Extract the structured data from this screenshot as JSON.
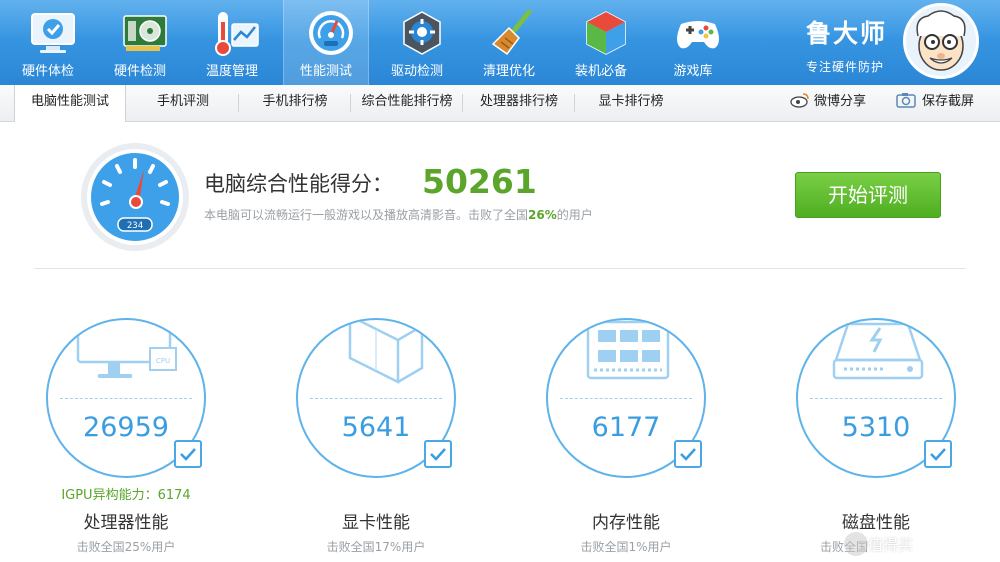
{
  "toolbar": {
    "items": [
      {
        "label": "硬件体检",
        "icon": "monitor-health-icon"
      },
      {
        "label": "硬件检测",
        "icon": "graphics-card-icon"
      },
      {
        "label": "温度管理",
        "icon": "thermometer-chart-icon"
      },
      {
        "label": "性能测试",
        "icon": "speedometer-icon"
      },
      {
        "label": "驱动检测",
        "icon": "gear-disc-icon"
      },
      {
        "label": "清理优化",
        "icon": "broom-icon"
      },
      {
        "label": "装机必备",
        "icon": "cube-box-icon"
      },
      {
        "label": "游戏库",
        "icon": "gamepad-icon"
      }
    ],
    "active_index": 3
  },
  "brand": {
    "name": "鲁大师",
    "slogan": "专注硬件防护",
    "avatar_icon": "ludashi-avatar-icon"
  },
  "tabs": {
    "items": [
      "电脑性能测试",
      "手机评测",
      "手机排行榜",
      "综合性能排行榜",
      "处理器排行榜",
      "显卡排行榜"
    ],
    "active_index": 0
  },
  "actions": {
    "share_label": "微博分享",
    "share_icon": "weibo-icon",
    "screenshot_label": "保存截屏",
    "screenshot_icon": "camera-icon"
  },
  "score": {
    "title": "电脑综合性能得分：",
    "value": "50261",
    "gauge_digits": "234",
    "desc_before": "本电脑可以流畅运行一般游戏以及播放高清影音。击败了全国",
    "desc_percent": "26%",
    "desc_after": "的用户"
  },
  "start_button": {
    "label": "开始评测"
  },
  "cards": [
    {
      "score": "26959",
      "title": "处理器性能",
      "sub": "击败全国25%用户",
      "extra": "IGPU异构能力：6174",
      "icon": "cpu-monitor-icon",
      "checked": true
    },
    {
      "score": "5641",
      "title": "显卡性能",
      "sub": "击败全国17%用户",
      "extra": "",
      "icon": "graphics-cube-icon",
      "checked": true
    },
    {
      "score": "6177",
      "title": "内存性能",
      "sub": "击败全国1%用户",
      "extra": "",
      "icon": "memory-chip-icon",
      "checked": true
    },
    {
      "score": "5310",
      "title": "磁盘性能",
      "sub": "击败全国",
      "extra": "",
      "icon": "disk-drive-icon",
      "checked": true
    }
  ],
  "colors": {
    "toolbar": "#2f8fdc",
    "accent_blue": "#3a9de0",
    "accent_green": "#5aa52a"
  },
  "watermark": {
    "text": "值得买"
  }
}
